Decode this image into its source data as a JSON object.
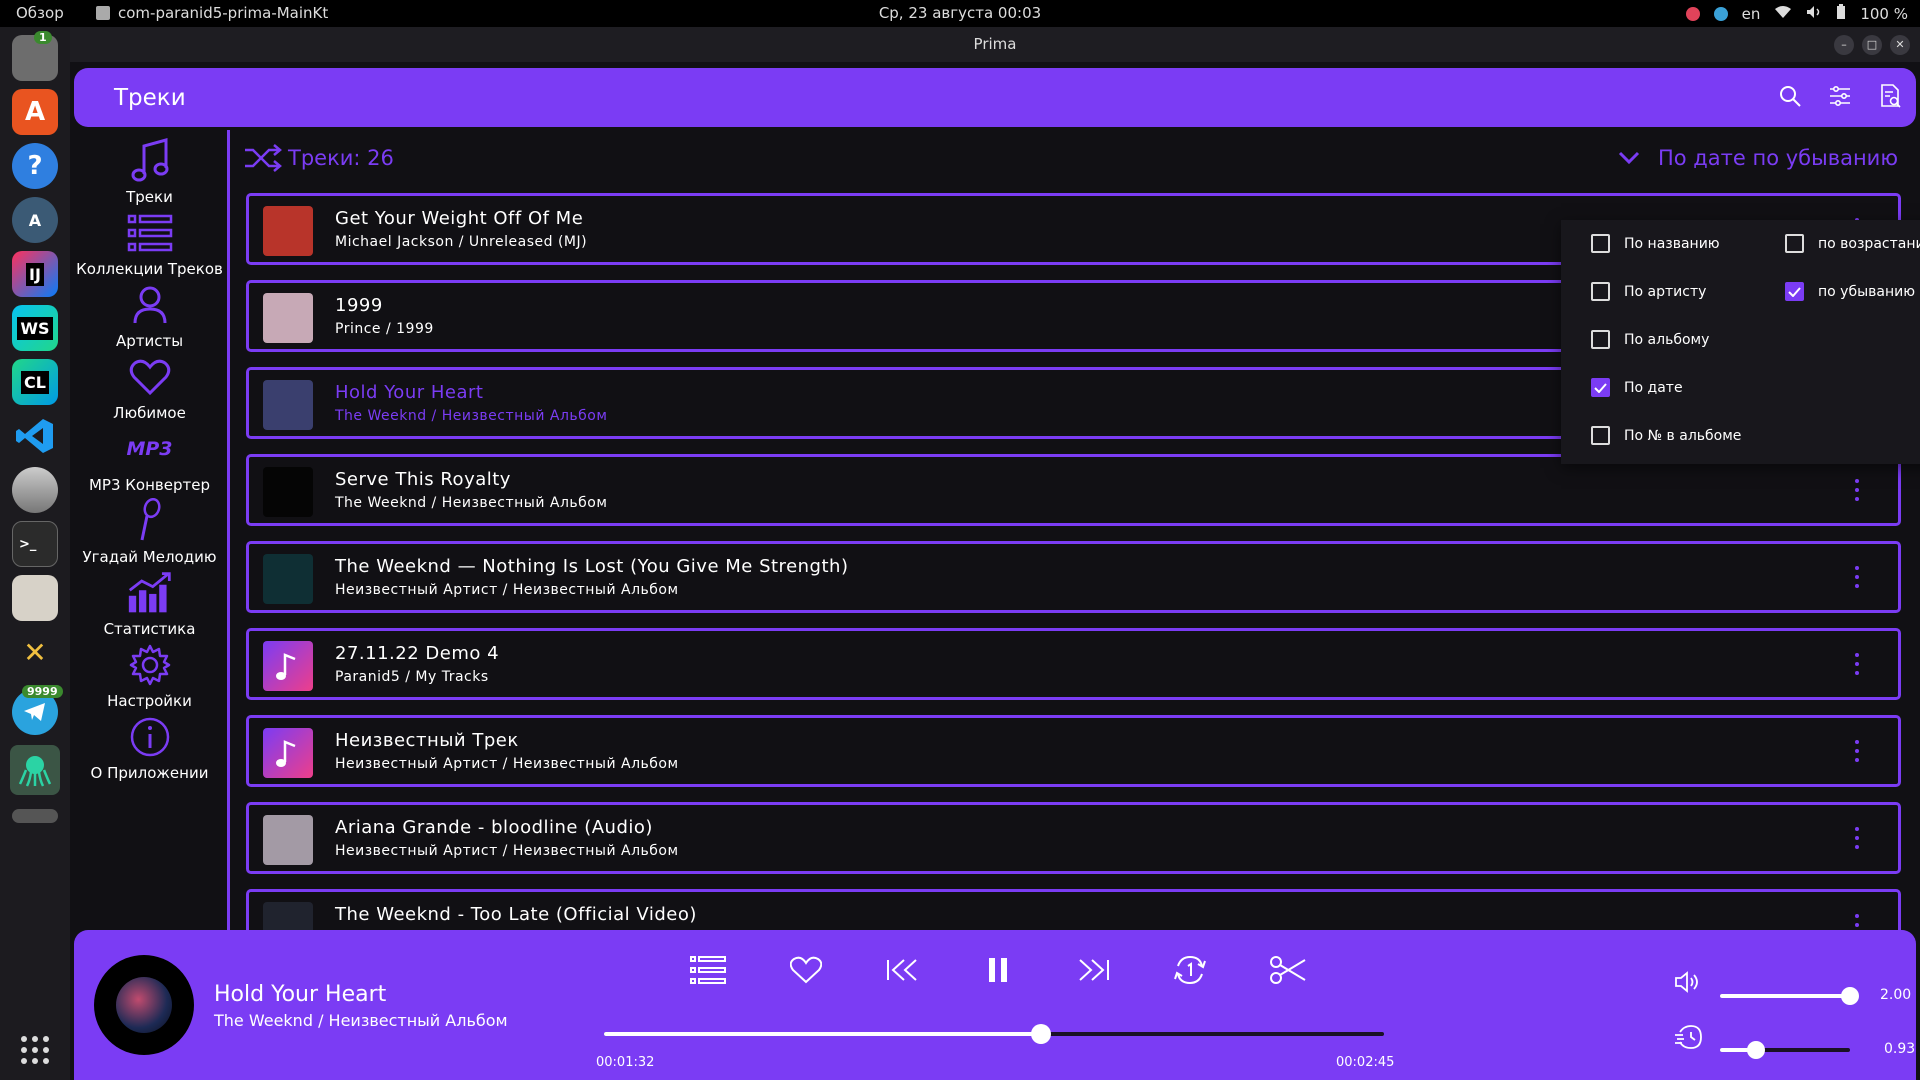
{
  "topbar": {
    "overview": "Обзор",
    "app": "com-paranid5-prima-MainKt",
    "clock": "Ср, 23 августа  00:03",
    "lang": "en",
    "battery": "100 %"
  },
  "dock": {
    "badge_top": "1",
    "badge_telegram": "9999",
    "ij": "IJ",
    "ws": "WS",
    "cl": "CL"
  },
  "window": {
    "title": "Prima"
  },
  "header": {
    "title": "Треки"
  },
  "nav": [
    {
      "label": "Треки"
    },
    {
      "label": "Коллекции Треков"
    },
    {
      "label": "Артисты"
    },
    {
      "label": "Любимое"
    },
    {
      "label": "MP3 Конвертер",
      "icon_text": "MP3"
    },
    {
      "label": "Угадай Мелодию"
    },
    {
      "label": "Статистика"
    },
    {
      "label": "Настройки"
    },
    {
      "label": "О Приложении"
    }
  ],
  "toolbar": {
    "count": "Треки: 26",
    "sort": "По дате по убыванию"
  },
  "tracks": [
    {
      "title": "Get Your Weight Off Of Me",
      "subtitle": "Michael Jackson / Unreleased (MJ)",
      "art": "#b8342a"
    },
    {
      "title": "1999",
      "subtitle": "Prince / 1999",
      "art": "#c7a9b6"
    },
    {
      "title": "Hold Your Heart",
      "subtitle": "The Weeknd / Неизвестный Альбом",
      "art": "#3a3f6e",
      "current": true
    },
    {
      "title": "Serve This Royalty",
      "subtitle": "The Weeknd / Неизвестный Альбом",
      "art": "#050505"
    },
    {
      "title": "The Weeknd — Nothing Is Lost (You Give Me Strength)",
      "subtitle": "Неизвестный Артист / Неизвестный Альбом",
      "art": "#0f2f34"
    },
    {
      "title": "27.11.22 Demo 4",
      "subtitle": "Paranid5 / My Tracks",
      "art": "gradient"
    },
    {
      "title": "Неизвестный Трек",
      "subtitle": "Неизвестный Артист / Неизвестный Альбом",
      "art": "gradient"
    },
    {
      "title": "Ariana Grande - bloodline (Audio)",
      "subtitle": "Неизвестный Артист / Неизвестный Альбом",
      "art": "#a39aa5"
    },
    {
      "title": "The Weeknd - Too Late (Official Video)",
      "subtitle": "",
      "art": "#20232e"
    }
  ],
  "sortmenu": {
    "by": [
      {
        "label": "По названию",
        "checked": false
      },
      {
        "label": "По артисту",
        "checked": false
      },
      {
        "label": "По альбому",
        "checked": false
      },
      {
        "label": "По дате",
        "checked": true
      },
      {
        "label": "По № в альбоме",
        "checked": false
      }
    ],
    "order": [
      {
        "label": "по возрастанию",
        "checked": false
      },
      {
        "label": "по убыванию",
        "checked": true
      }
    ]
  },
  "player": {
    "title": "Hold Your Heart",
    "subtitle": "The Weeknd / Неизвестный Альбом",
    "elapsed": "00:01:32",
    "duration": "00:02:45",
    "progress": 0.56,
    "volume": 1.0,
    "volume_label": "2.00",
    "speed": 0.28,
    "speed_label": "0.93"
  },
  "colors": {
    "accent": "#7b3cf4",
    "background": "#111014"
  }
}
